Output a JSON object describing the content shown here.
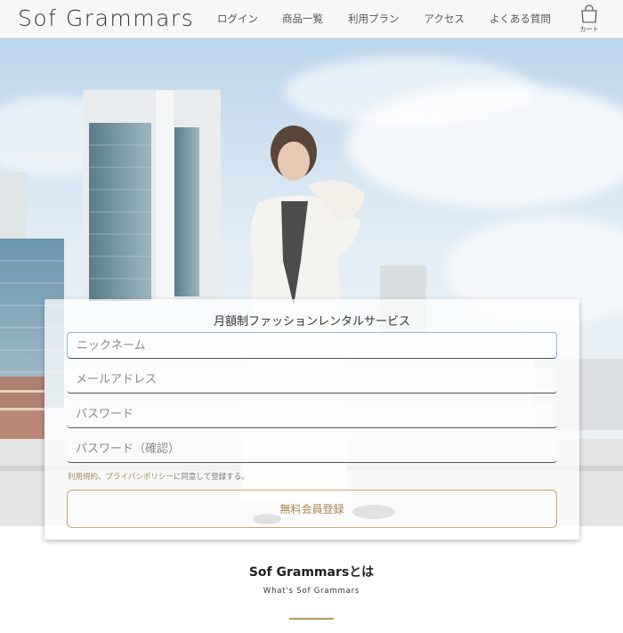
{
  "header": {
    "logo": "Sof Grammars",
    "nav": [
      "ログイン",
      "商品一覧",
      "利用プラン",
      "アクセス",
      "よくある質問"
    ],
    "cart_label": "カート",
    "cart_icon": "shopping-bag-icon"
  },
  "signup": {
    "title": "月額制ファッションレンタルサービス",
    "fields": {
      "nickname": "ニックネーム",
      "email": "メールアドレス",
      "password": "パスワード",
      "password_confirm": "パスワード（確認）"
    },
    "terms": {
      "link1": "利用規約",
      "sep": "、",
      "link2": "プライバシポリシー",
      "rest": "に同意して登録する。"
    },
    "submit_label": "無料会員登録"
  },
  "about": {
    "title": "Sof Grammarsとは",
    "subtitle": "What's Sof Grammars"
  },
  "colors": {
    "accent_gold": "#c9ab6e",
    "link_gold": "#a08a55",
    "header_bg": "#f7f7f7"
  }
}
